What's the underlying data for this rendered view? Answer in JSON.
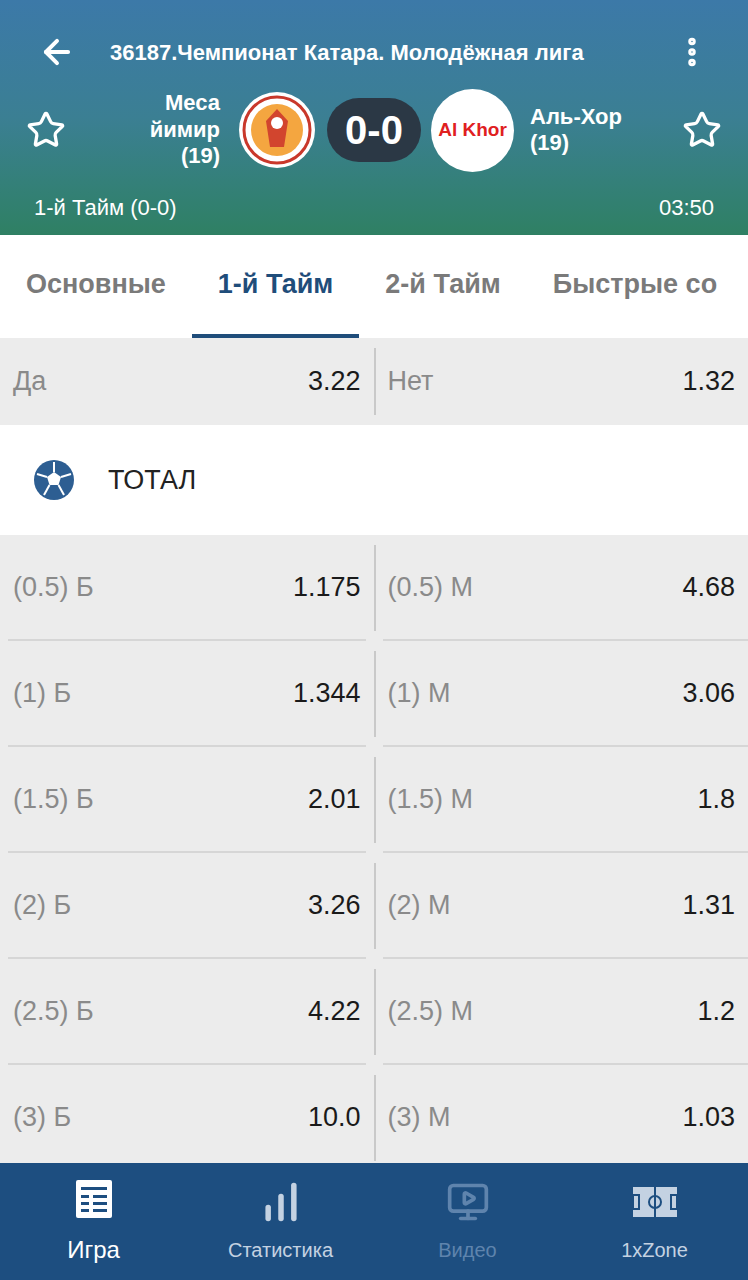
{
  "header": {
    "title": "36187.Чемпионат Катара. Молодёжная лига",
    "home": {
      "name": "Меса йимир",
      "age": "(19)",
      "favorite": false
    },
    "away": {
      "name": "Аль-Хор",
      "age": "(19)",
      "logo_text": "Al Khor",
      "favorite": false
    },
    "score": "0-0",
    "period": "1-й Тайм (0-0)",
    "time": "03:50"
  },
  "tabs": [
    {
      "label": "Основные",
      "selected": false
    },
    {
      "label": "1-й Тайм",
      "selected": true
    },
    {
      "label": "2-й Тайм",
      "selected": false
    },
    {
      "label": "Быстрые со",
      "selected": false
    }
  ],
  "yes_no": [
    {
      "label": "Да",
      "odds": "3.22"
    },
    {
      "label": "Нет",
      "odds": "1.32"
    }
  ],
  "total": {
    "title": "ТОТАЛ",
    "rows": [
      {
        "over": {
          "label": "(0.5) Б",
          "odds": "1.175"
        },
        "under": {
          "label": "(0.5) М",
          "odds": "4.68"
        }
      },
      {
        "over": {
          "label": "(1) Б",
          "odds": "1.344"
        },
        "under": {
          "label": "(1) М",
          "odds": "3.06"
        }
      },
      {
        "over": {
          "label": "(1.5) Б",
          "odds": "2.01"
        },
        "under": {
          "label": "(1.5) М",
          "odds": "1.8"
        }
      },
      {
        "over": {
          "label": "(2) Б",
          "odds": "3.26"
        },
        "under": {
          "label": "(2) М",
          "odds": "1.31"
        }
      },
      {
        "over": {
          "label": "(2.5) Б",
          "odds": "4.22"
        },
        "under": {
          "label": "(2.5) М",
          "odds": "1.2"
        }
      },
      {
        "over": {
          "label": "(3) Б",
          "odds": "10.0"
        },
        "under": {
          "label": "(3) М",
          "odds": "1.03"
        }
      }
    ]
  },
  "bottom_nav": [
    {
      "label": "Игра",
      "selected": true,
      "disabled": false
    },
    {
      "label": "Статистика",
      "selected": false,
      "disabled": false
    },
    {
      "label": "Видео",
      "selected": false,
      "disabled": true
    },
    {
      "label": "1xZone",
      "selected": false,
      "disabled": false
    }
  ]
}
